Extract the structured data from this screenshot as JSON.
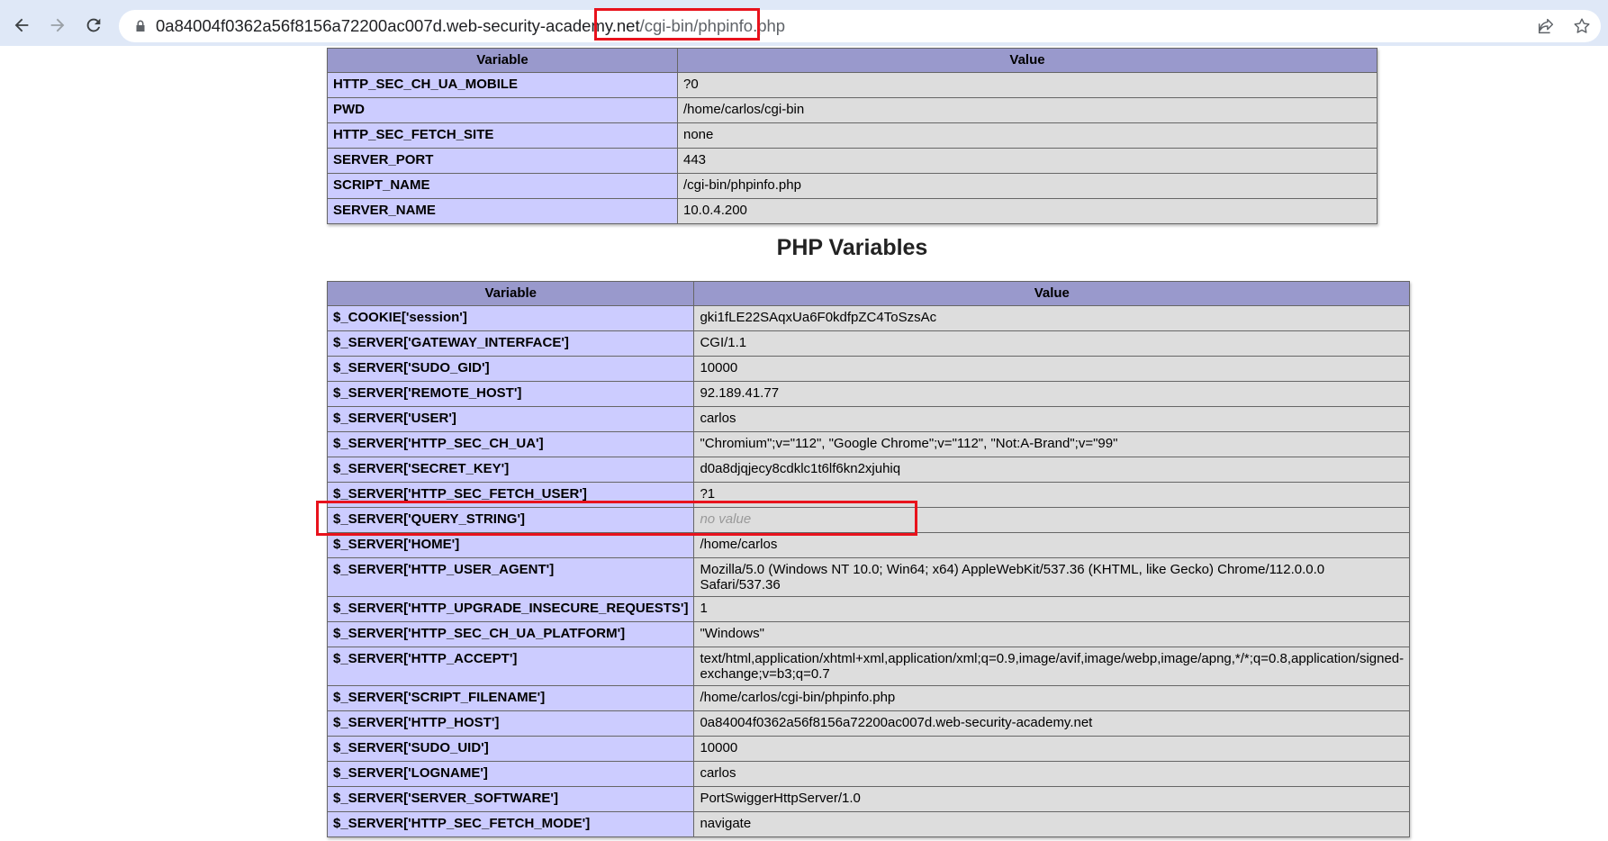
{
  "browser": {
    "url_host": "0a84004f0362a56f8156a72200ac007d.web-security-academy.ne",
    "url_mid": "t",
    "url_path": "/cgi-bin/phpinfo.php",
    "icons": [
      "back-arrow-icon",
      "forward-arrow-icon",
      "reload-icon",
      "lock-icon",
      "share-icon",
      "bookmark-star-icon"
    ]
  },
  "env_table": {
    "headers": [
      "Variable",
      "Value"
    ],
    "rows": [
      {
        "name": "HTTP_SEC_CH_UA_MOBILE",
        "value": "?0"
      },
      {
        "name": "PWD",
        "value": "/home/carlos/cgi-bin"
      },
      {
        "name": "HTTP_SEC_FETCH_SITE",
        "value": "none"
      },
      {
        "name": "SERVER_PORT",
        "value": "443"
      },
      {
        "name": "SCRIPT_NAME",
        "value": "/cgi-bin/phpinfo.php"
      },
      {
        "name": "SERVER_NAME",
        "value": "10.0.4.200"
      }
    ]
  },
  "php_variables": {
    "title": "PHP Variables",
    "headers": [
      "Variable",
      "Value"
    ],
    "rows": [
      {
        "name": "$_COOKIE['session']",
        "value": "gki1fLE22SAqxUa6F0kdfpZC4ToSzsAc"
      },
      {
        "name": "$_SERVER['GATEWAY_INTERFACE']",
        "value": "CGI/1.1"
      },
      {
        "name": "$_SERVER['SUDO_GID']",
        "value": "10000"
      },
      {
        "name": "$_SERVER['REMOTE_HOST']",
        "value": "92.189.41.77"
      },
      {
        "name": "$_SERVER['USER']",
        "value": "carlos"
      },
      {
        "name": "$_SERVER['HTTP_SEC_CH_UA']",
        "value": "\"Chromium\";v=\"112\", \"Google Chrome\";v=\"112\", \"Not:A-Brand\";v=\"99\""
      },
      {
        "name": "$_SERVER['SECRET_KEY']",
        "value": "d0a8djqjecy8cdklc1t6lf6kn2xjuhiq"
      },
      {
        "name": "$_SERVER['HTTP_SEC_FETCH_USER']",
        "value": "?1"
      },
      {
        "name": "$_SERVER['QUERY_STRING']",
        "value": "no value"
      },
      {
        "name": "$_SERVER['HOME']",
        "value": "/home/carlos"
      },
      {
        "name": "$_SERVER['HTTP_USER_AGENT']",
        "value": "Mozilla/5.0 (Windows NT 10.0; Win64; x64) AppleWebKit/537.36 (KHTML, like Gecko) Chrome/112.0.0.0 Safari/537.36"
      },
      {
        "name": "$_SERVER['HTTP_UPGRADE_INSECURE_REQUESTS']",
        "value": "1"
      },
      {
        "name": "$_SERVER['HTTP_SEC_CH_UA_PLATFORM']",
        "value": "\"Windows\""
      },
      {
        "name": "$_SERVER['HTTP_ACCEPT']",
        "value": "text/html,application/xhtml+xml,application/xml;q=0.9,image/avif,image/webp,image/apng,*/*;q=0.8,application/signed-exchange;v=b3;q=0.7"
      },
      {
        "name": "$_SERVER['SCRIPT_FILENAME']",
        "value": "/home/carlos/cgi-bin/phpinfo.php"
      },
      {
        "name": "$_SERVER['HTTP_HOST']",
        "value": "0a84004f0362a56f8156a72200ac007d.web-security-academy.net"
      },
      {
        "name": "$_SERVER['SUDO_UID']",
        "value": "10000"
      },
      {
        "name": "$_SERVER['LOGNAME']",
        "value": "carlos"
      },
      {
        "name": "$_SERVER['SERVER_SOFTWARE']",
        "value": "PortSwiggerHttpServer/1.0"
      },
      {
        "name": "$_SERVER['HTTP_SEC_FETCH_MODE']",
        "value": "navigate"
      }
    ]
  },
  "colors": {
    "highlight": "#e8121c",
    "header_bg": "#9999cc",
    "name_cell_bg": "#ccccff",
    "value_cell_bg": "#dddddd"
  }
}
